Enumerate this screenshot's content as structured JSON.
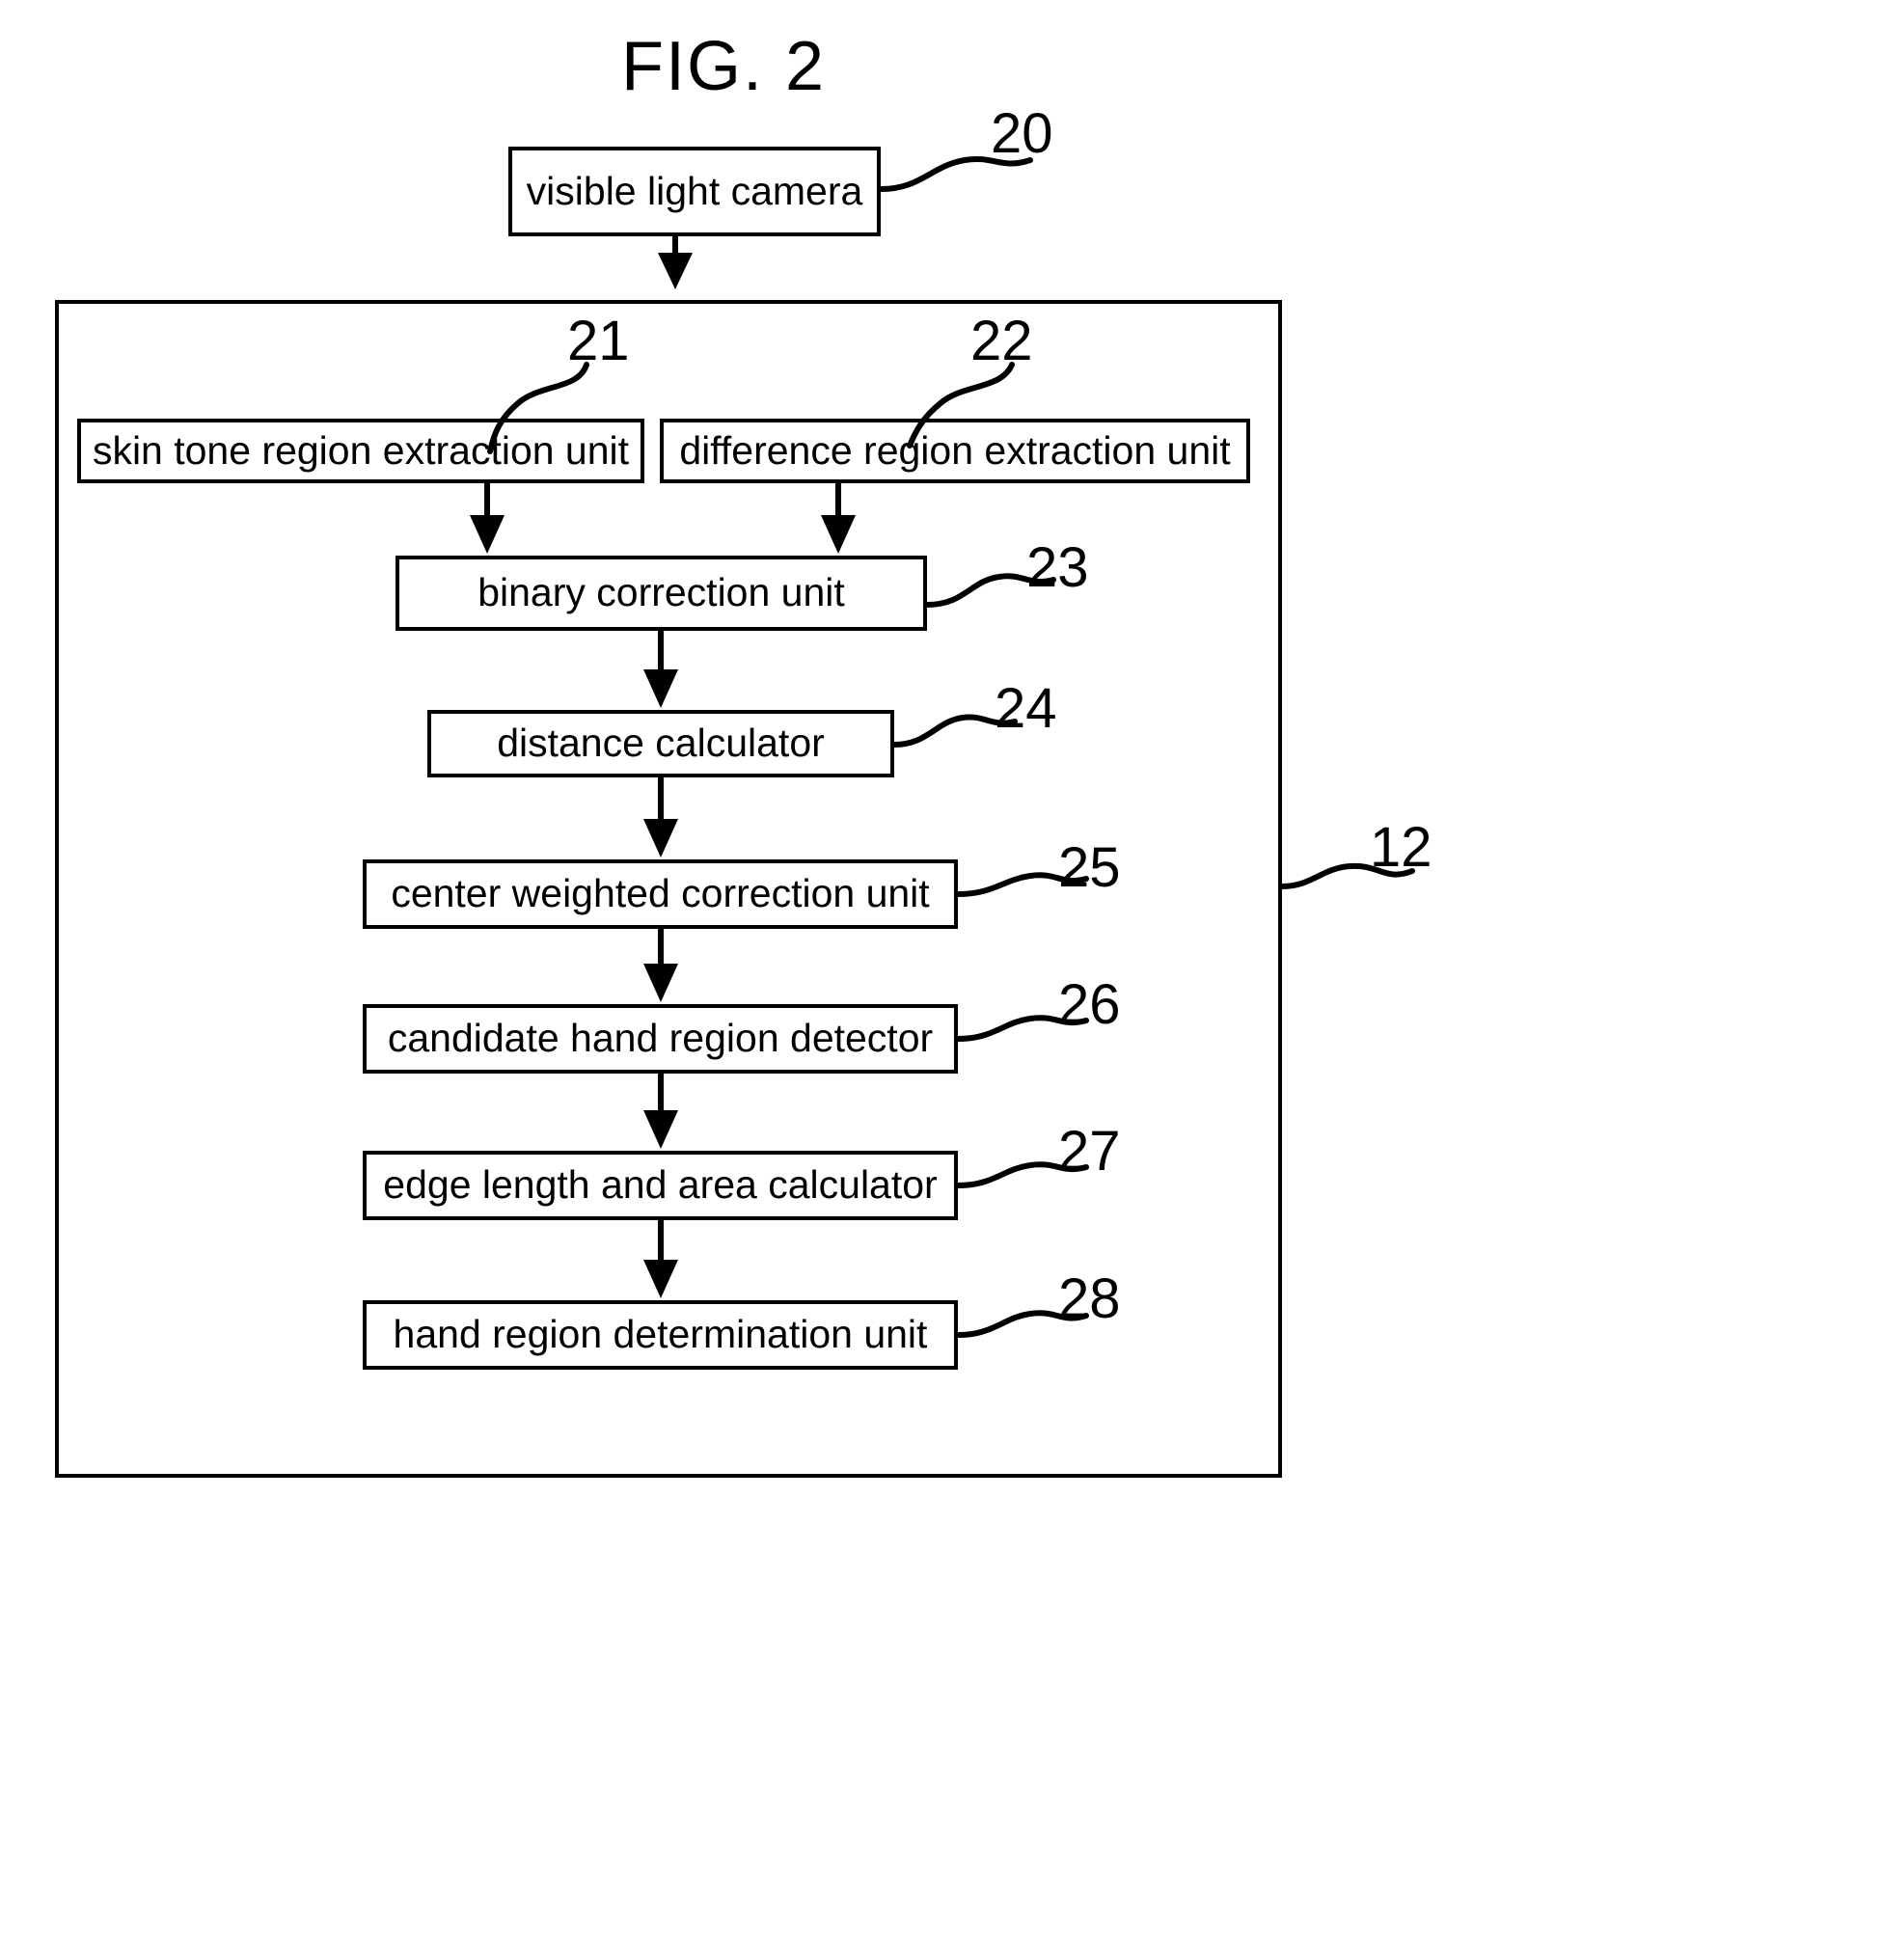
{
  "figure": {
    "title": "FIG. 2",
    "type": "patent-block-diagram"
  },
  "nodes": {
    "camera": {
      "label": "visible light camera",
      "ref": "20"
    },
    "skin_tone": {
      "label": "skin tone region extraction unit",
      "ref": "21"
    },
    "difference": {
      "label": "difference region extraction unit",
      "ref": "22"
    },
    "binary": {
      "label": "binary correction unit",
      "ref": "23"
    },
    "distance": {
      "label": "distance calculator",
      "ref": "24"
    },
    "center_weighted": {
      "label": "center weighted correction unit",
      "ref": "25"
    },
    "candidate": {
      "label": "candidate hand region detector",
      "ref": "26"
    },
    "edge_area": {
      "label": "edge length and area calculator",
      "ref": "27"
    },
    "hand_determination": {
      "label": "hand region determination unit",
      "ref": "28"
    },
    "container": {
      "label": "",
      "ref": "12"
    }
  },
  "colors": {
    "stroke": "#000000",
    "background": "#ffffff"
  }
}
